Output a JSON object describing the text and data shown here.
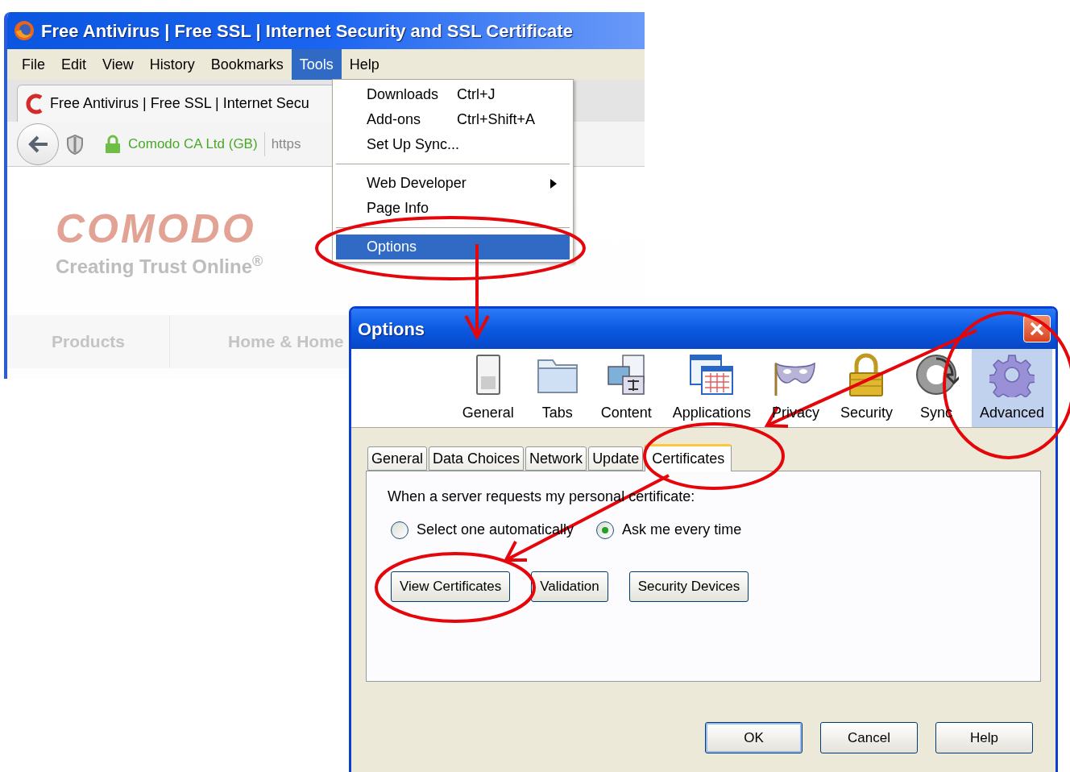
{
  "browser": {
    "title": "Free Antivirus | Free SSL | Internet Security and SSL Certificate",
    "menu_bar": [
      {
        "label": "File",
        "selected": false
      },
      {
        "label": "Edit",
        "selected": false
      },
      {
        "label": "View",
        "selected": false
      },
      {
        "label": "History",
        "selected": false
      },
      {
        "label": "Bookmarks",
        "selected": false
      },
      {
        "label": "Tools",
        "selected": true
      },
      {
        "label": "Help",
        "selected": false
      }
    ],
    "tab_title": "Free Antivirus | Free SSL | Internet Secu",
    "identity": "Comodo CA Ltd (GB)",
    "url": "https",
    "page": {
      "logo": "COMODO",
      "tagline": "Creating Trust Online$^{®}$",
      "nav": [
        "Products",
        "Home & Home"
      ]
    }
  },
  "tools_menu": [
    {
      "kind": "item",
      "label": "Downloads",
      "shortcut": "Ctrl+J",
      "selected": false
    },
    {
      "kind": "item",
      "label": "Add-ons",
      "shortcut": "Ctrl+Shift+A",
      "selected": false
    },
    {
      "kind": "item",
      "label": "Set Up Sync...",
      "selected": false
    },
    {
      "kind": "separator"
    },
    {
      "kind": "submenu",
      "label": "Web Developer",
      "selected": false
    },
    {
      "kind": "item",
      "label": "Page Info",
      "selected": false
    },
    {
      "kind": "separator"
    },
    {
      "kind": "item",
      "label": "Options",
      "selected": true
    }
  ],
  "dialog": {
    "title": "Options",
    "panes": [
      {
        "label": "General",
        "selected": false
      },
      {
        "label": "Tabs",
        "selected": false
      },
      {
        "label": "Content",
        "selected": false
      },
      {
        "label": "Applications",
        "selected": false
      },
      {
        "label": "Privacy",
        "selected": false
      },
      {
        "label": "Security",
        "selected": false
      },
      {
        "label": "Sync",
        "selected": false
      },
      {
        "label": "Advanced",
        "selected": true
      }
    ],
    "subtabs": [
      {
        "label": "General",
        "selected": false
      },
      {
        "label": "Data Choices",
        "selected": false
      },
      {
        "label": "Network",
        "selected": false
      },
      {
        "label": "Update",
        "selected": false
      },
      {
        "label": "Certificates",
        "selected": true
      }
    ],
    "prompt": "When a server requests my personal certificate:",
    "radios": [
      {
        "label": "Select one automatically",
        "checked": false
      },
      {
        "label": "Ask me every time",
        "checked": true
      }
    ],
    "buttons": [
      "View Certificates",
      "Validation",
      "Security Devices"
    ],
    "footer_buttons": [
      {
        "label": "OK",
        "default": true
      },
      {
        "label": "Cancel",
        "default": false
      },
      {
        "label": "Help",
        "default": false
      }
    ]
  }
}
